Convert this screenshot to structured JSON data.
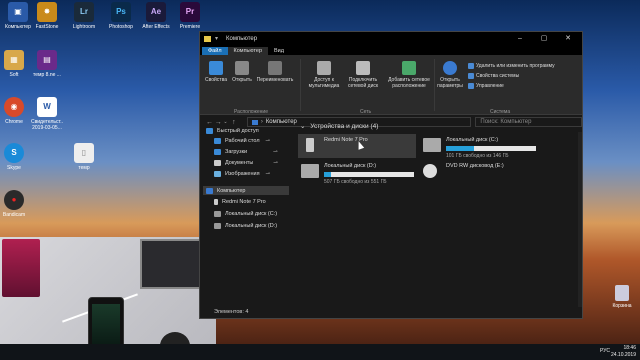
{
  "desktop": {
    "icons": [
      {
        "label": "Компьютер",
        "color": "#2a5aa8",
        "glyph": "▣"
      },
      {
        "label": "FastStone",
        "color": "#c98a1a",
        "glyph": "✸"
      },
      {
        "label": "Lightroom",
        "color": "#1a2a3a",
        "glyph": "Lr"
      },
      {
        "label": "Photoshop",
        "color": "#0a2a4a",
        "glyph": "Ps"
      },
      {
        "label": "After Effects",
        "color": "#1a1a3a",
        "glyph": "Ae"
      },
      {
        "label": "Premiere",
        "color": "#2a0a3a",
        "glyph": "Pr"
      },
      {
        "label": "Soft",
        "color": "#d8a84a",
        "glyph": "▦"
      },
      {
        "label": "темр 8.ne ...",
        "color": "#6a2a8a",
        "glyph": "▤"
      },
      {
        "label": "Chrome",
        "color": "#d84a2a",
        "glyph": "◉"
      },
      {
        "label": "Свидетельст.. 2019-03-05...",
        "color": "#ffffff",
        "glyph": "W"
      },
      {
        "label": "Skype",
        "color": "#1a8ad8",
        "glyph": "S"
      },
      {
        "label": "темр",
        "color": "#eeeeee",
        "glyph": "▯"
      },
      {
        "label": "Bandicam",
        "color": "#2a2a2a",
        "glyph": "●"
      }
    ],
    "trash_label": "Корзина"
  },
  "window": {
    "title": "Компьютер",
    "tabs": [
      "Файл",
      "Компьютер",
      "Вид"
    ],
    "ribbon": {
      "location_group": "Расположение",
      "network_group": "Сеть",
      "system_group": "Система",
      "buttons": {
        "properties": "Свойства",
        "open": "Открыть",
        "rename": "Переименовать",
        "media_access": "Доступ к мультимедиа",
        "map_drive": "Подключить сетевой диск",
        "add_location": "Добавить сетевое расположение",
        "open_settings": "Открыть параметры"
      },
      "system_links": [
        "Удалить или изменить программу",
        "Свойства системы",
        "Управление"
      ]
    },
    "address": {
      "path": "Компьютер",
      "search_placeholder": "Поиск: Компьютер"
    },
    "nav": {
      "quick_access": "Быстрый доступ",
      "items": [
        "Рабочий стол",
        "Загрузки",
        "Документы",
        "Изображения"
      ],
      "computer": "Компьютер",
      "sub_items": [
        "Redmi Note 7 Pro",
        "Локальный диск (C:)",
        "Локальный диск (D:)"
      ]
    },
    "section_title": "Устройства и диски (4)",
    "drives": [
      {
        "name": "Redmi Note 7 Pro",
        "free_text": "",
        "used_fraction": null
      },
      {
        "name": "Локальный диск (C:)",
        "free_text": "101 ГБ свободно из 146 ГБ",
        "used_fraction": 0.31
      },
      {
        "name": "Локальный диск (D:)",
        "free_text": "507 ГБ свободно из 551 ГБ",
        "used_fraction": 0.08
      },
      {
        "name": "DVD RW дисковод (E:)",
        "free_text": "",
        "used_fraction": null
      }
    ],
    "status": "Элементов: 4"
  },
  "taskbar": {
    "lang": "РУС",
    "time": "18:46",
    "date": "24.10.2019"
  }
}
